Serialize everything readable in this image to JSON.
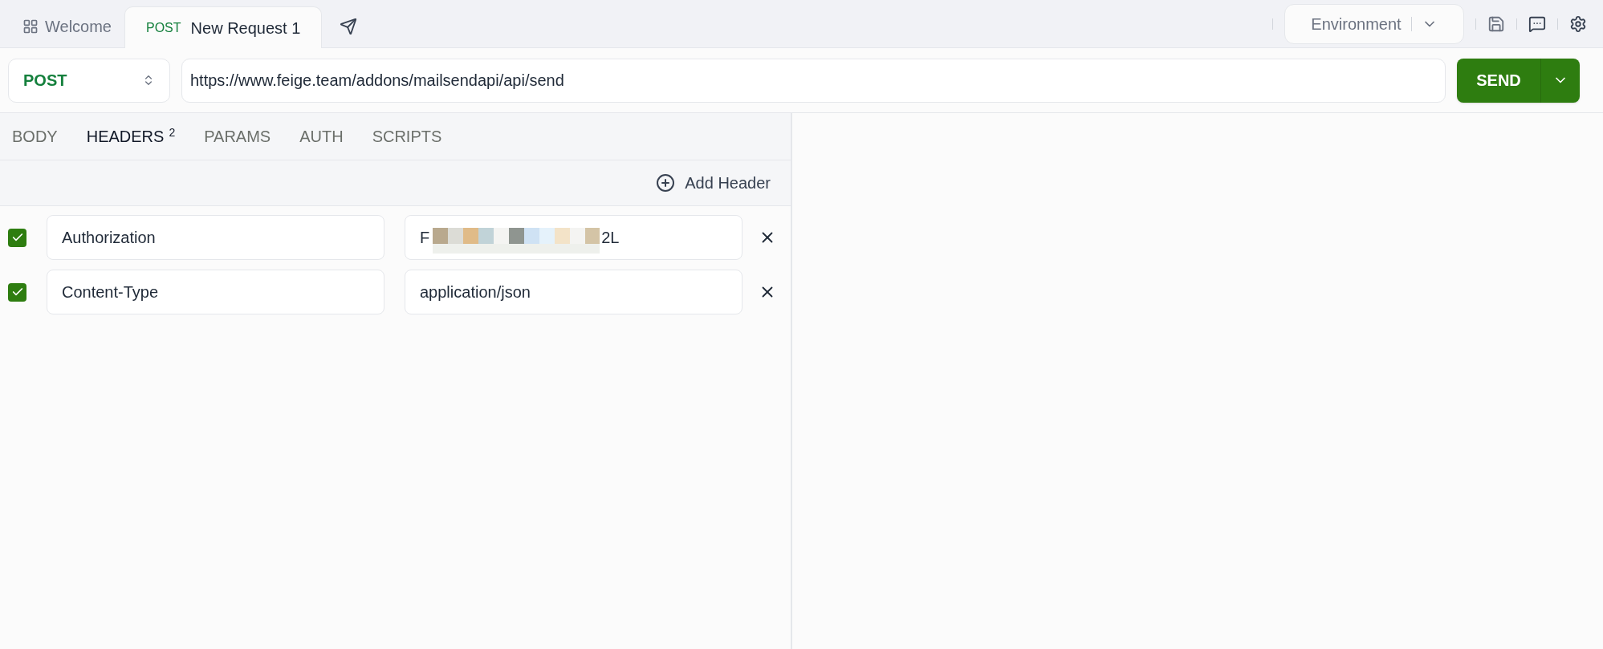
{
  "tabs": [
    {
      "kind": "home",
      "label": "Welcome",
      "selected": false
    },
    {
      "kind": "request",
      "method": "POST",
      "label": "New Request 1",
      "selected": true
    }
  ],
  "environment": {
    "label": "Environment"
  },
  "request": {
    "method": "POST",
    "url": "https://www.feige.team/addons/mailsendapi/api/send",
    "send_label": "SEND"
  },
  "section_tabs": [
    {
      "label": "BODY",
      "selected": false
    },
    {
      "label": "HEADERS",
      "count": "2",
      "selected": true
    },
    {
      "label": "PARAMS",
      "selected": false
    },
    {
      "label": "AUTH",
      "selected": false
    },
    {
      "label": "SCRIPTS",
      "selected": false
    }
  ],
  "add_header_label": "Add Header",
  "headers": [
    {
      "checked": true,
      "key": "Authorization",
      "value_parts": [
        "F",
        "2L"
      ],
      "redacted": true
    },
    {
      "checked": true,
      "key": "Content-Type",
      "value_parts": [
        "application/json"
      ],
      "redacted": false
    }
  ]
}
